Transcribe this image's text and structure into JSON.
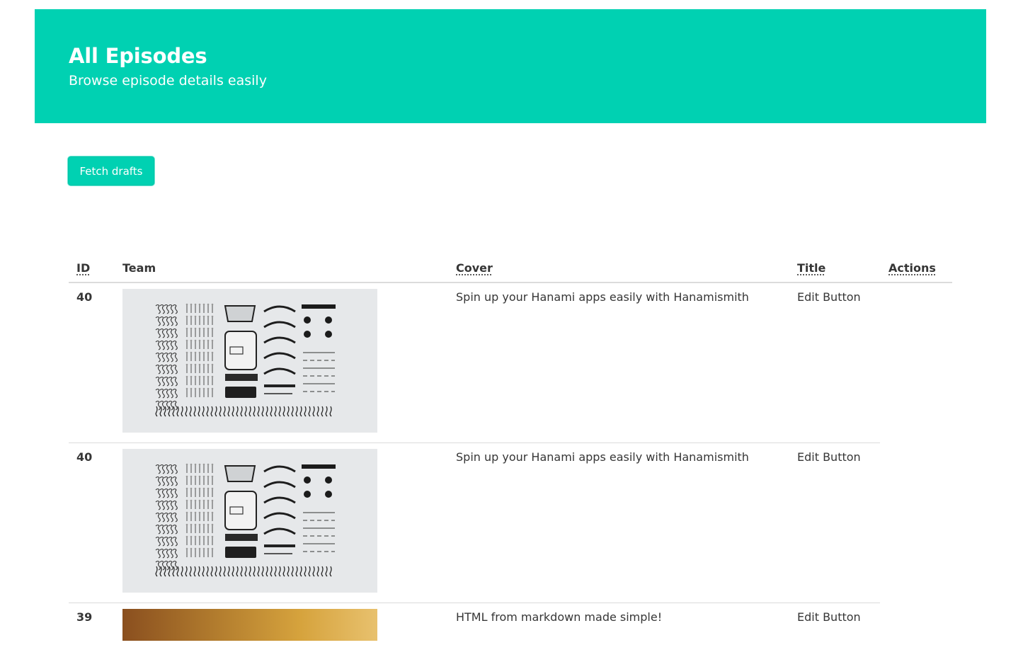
{
  "header": {
    "title": "All Episodes",
    "subtitle": "Browse episode details easily"
  },
  "toolbar": {
    "fetch_label": "Fetch drafts"
  },
  "table": {
    "headers": {
      "id": "ID",
      "team": "Team",
      "cover": "Cover",
      "title": "Title",
      "actions": "Actions"
    },
    "rows": [
      {
        "id": "40",
        "cover_image": "typewriter-parts-flatlay",
        "text": "Spin up your Hanami apps easily with Hanamismith",
        "action": "Edit Button"
      },
      {
        "id": "40",
        "cover_image": "typewriter-parts-flatlay",
        "text": "Spin up your Hanami apps easily with Hanamismith",
        "action": "Edit Button"
      },
      {
        "id": "39",
        "cover_image": "golden-gradient",
        "text": "HTML from markdown made simple!",
        "action": "Edit Button"
      }
    ]
  },
  "colors": {
    "primary": "#00d1b2",
    "text": "#363636",
    "border": "#dbdbdb"
  }
}
